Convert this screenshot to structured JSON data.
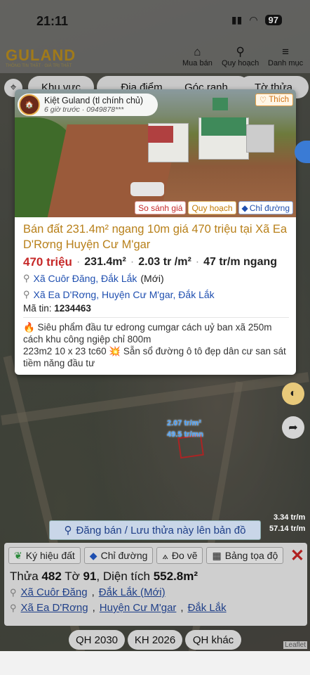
{
  "status": {
    "time": "21:11",
    "battery": "97"
  },
  "header": {
    "logo": "GULAND",
    "tagline": "THÔNG TIN THẬT · GIÁ TRỊ THẬT",
    "nav": [
      {
        "label": "Mua bán",
        "icon": "store-icon"
      },
      {
        "label": "Quy hoạch",
        "icon": "map-search-icon"
      },
      {
        "label": "Danh mục",
        "icon": "menu-icon"
      }
    ]
  },
  "filters": [
    "Khu vực",
    "Địa điểm",
    "Góc ranh",
    "Tờ thửa"
  ],
  "listing": {
    "poster_name": "Kiệt Guland (tl chính chủ)",
    "time_ago": "6 giờ trước",
    "phone": "0949878***",
    "like_label": "Thích",
    "photo_buttons": [
      "So sánh giá",
      "Quy hoạch",
      "Chỉ đường"
    ],
    "title": "Bán đất 231.4m² ngang 10m giá 470 triệu tại Xã Ea D'Rơng Huyện Cư M'gar",
    "price": "470 triệu",
    "area": "231.4m²",
    "unit_price": "2.03 tr /m²",
    "frontage_price": "47 tr/m ngang",
    "address_new_link": "Xã Cuôr Đăng, Đắk Lắk",
    "address_new_tag": "(Mới)",
    "address_old_link": "Xã Ea D'Rơng, Huyện Cư M'gar, Đắk Lắk",
    "code_label": "Mã tin:",
    "code": "1234463",
    "description_line1": "🔥 Siêu phẩm đầu tư edrong cumgar cách uỷ ban xã 250m cách khu công ngiệp chỉ 800m",
    "description_line2": "223m2 10 x 23 tc60 💥 Sẵn sổ đường ô tô đẹp dân cư san sát tiềm năng đầu tư"
  },
  "map_labels": {
    "plot_price1": "2.07 tr/m²",
    "plot_price2": "49.5 tr/mn",
    "side_price1": "3.34 tr/m",
    "side_price2": "57.14 tr/m"
  },
  "dang_ban": "Đăng bán / Lưu thửa này lên bản đồ",
  "panel": {
    "chips": [
      "Ký hiệu đất",
      "Chỉ đường",
      "Đo vẽ",
      "Bảng tọa độ"
    ],
    "thua_label": "Thửa",
    "thua": "482",
    "to_label": "Tờ",
    "to": "91",
    "dientich_label": ", Diện tích",
    "dientich": "552.8m²",
    "addr1_a": "Xã Cuôr Đăng",
    "addr1_b": "Đắk Lắk (Mới)",
    "addr2_a": "Xã Ea D'Rơng",
    "addr2_b": "Huyện Cư M'gar",
    "addr2_c": "Đắk Lắk"
  },
  "qh_buttons": [
    "QH 2030",
    "KH 2026",
    "QH khác"
  ],
  "attribution": "Leaflet"
}
